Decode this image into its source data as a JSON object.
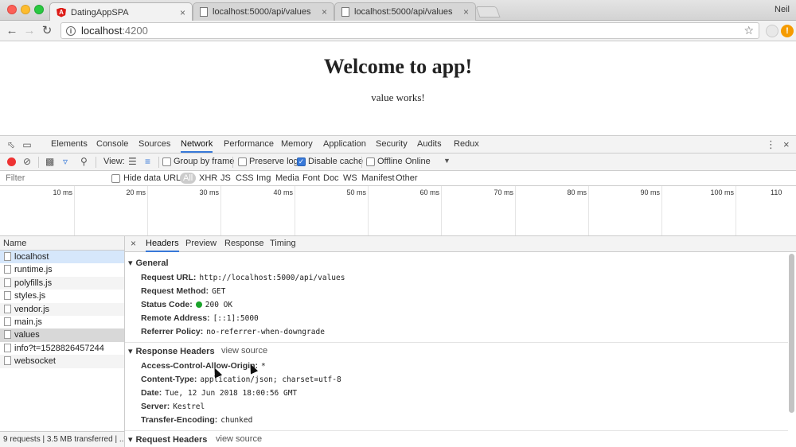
{
  "browser": {
    "tabs": [
      {
        "title": "DatingAppSPA",
        "active": true
      },
      {
        "title": "localhost:5000/api/values",
        "active": false
      },
      {
        "title": "localhost:5000/api/values",
        "active": false
      }
    ],
    "user": "Neil",
    "url_host": "localhost",
    "url_port": ":4200"
  },
  "page": {
    "heading": "Welcome to app!",
    "value_text": "value works!"
  },
  "devtools": {
    "tabs": [
      "Elements",
      "Console",
      "Sources",
      "Network",
      "Performance",
      "Memory",
      "Application",
      "Security",
      "Audits",
      "Redux"
    ],
    "active_tab": "Network",
    "toolbar": {
      "view_label": "View:",
      "group_by_frame": "Group by frame",
      "preserve_log": "Preserve log",
      "disable_cache": "Disable cache",
      "offline": "Offline",
      "throttle": "Online"
    },
    "filter": {
      "placeholder": "Filter",
      "hide_data_urls": "Hide data URLs",
      "types": [
        "All",
        "XHR",
        "JS",
        "CSS",
        "Img",
        "Media",
        "Font",
        "Doc",
        "WS",
        "Manifest",
        "Other"
      ]
    },
    "timeline_ticks": [
      "10 ms",
      "20 ms",
      "30 ms",
      "40 ms",
      "50 ms",
      "60 ms",
      "70 ms",
      "80 ms",
      "90 ms",
      "100 ms",
      "110"
    ],
    "requests": {
      "header": "Name",
      "items": [
        "localhost",
        "runtime.js",
        "polyfills.js",
        "styles.js",
        "vendor.js",
        "main.js",
        "values",
        "info?t=1528826457244",
        "websocket"
      ],
      "status": "9 requests | 3.5 MB transferred | ..."
    },
    "detail": {
      "tabs": [
        "Headers",
        "Preview",
        "Response",
        "Timing"
      ],
      "active_tab": "Headers",
      "general": {
        "title": "General",
        "rows": [
          {
            "key": "Request URL:",
            "value": "http://localhost:5000/api/values"
          },
          {
            "key": "Request Method:",
            "value": "GET"
          },
          {
            "key": "Status Code:",
            "value": "200 OK"
          },
          {
            "key": "Remote Address:",
            "value": "[::1]:5000"
          },
          {
            "key": "Referrer Policy:",
            "value": "no-referrer-when-downgrade"
          }
        ]
      },
      "response_headers": {
        "title": "Response Headers",
        "view_source": "view source",
        "rows": [
          {
            "key": "Access-Control-Allow-Origin:",
            "value": "*"
          },
          {
            "key": "Content-Type:",
            "value": "application/json; charset=utf-8"
          },
          {
            "key": "Date:",
            "value": "Tue, 12 Jun 2018 18:00:56 GMT"
          },
          {
            "key": "Server:",
            "value": "Kestrel"
          },
          {
            "key": "Transfer-Encoding:",
            "value": "chunked"
          }
        ]
      },
      "request_headers": {
        "title": "Request Headers",
        "view_source": "view source"
      }
    }
  },
  "colors": {
    "accent": "#3879d9",
    "record": "#ee3333",
    "status_ok": "#1aa32a"
  }
}
